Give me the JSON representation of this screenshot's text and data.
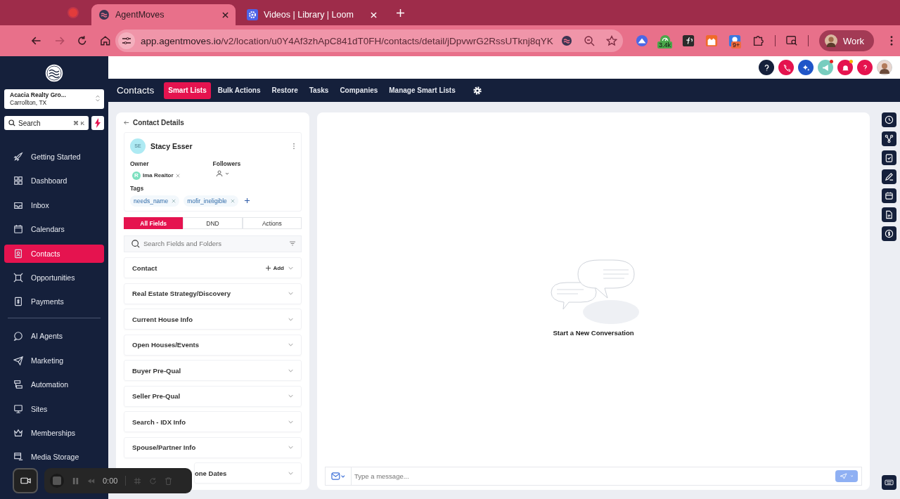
{
  "browser": {
    "tabs": [
      {
        "title": "AgentMoves",
        "selected": true
      },
      {
        "title": "Videos | Library | Loom",
        "selected": false
      }
    ],
    "url_host": "app.agentmoves.io",
    "url_path": "/v2/location/u0Y4Af3zhApC841dT0FH/contacts/detail/jDpvwrG2RssUTknj8qYK",
    "extensions": [
      {
        "kind": "plain"
      },
      {
        "kind": "badged",
        "badge": "3.4k"
      },
      {
        "kind": "plain"
      },
      {
        "kind": "plain"
      },
      {
        "kind": "badged",
        "badge": "9+"
      },
      {
        "kind": "plain"
      }
    ],
    "profile": "Work"
  },
  "sidebar": {
    "account": {
      "name": "Acacia Realty Gro...",
      "location": "Carrollton, TX"
    },
    "search": {
      "label": "Search",
      "shortcut": "⌘ K"
    },
    "nav_groups": [
      {
        "items": [
          {
            "label": "Getting Started",
            "selected": false
          },
          {
            "label": "Dashboard",
            "selected": false
          },
          {
            "label": "Inbox",
            "selected": false
          },
          {
            "label": "Calendars",
            "selected": false
          },
          {
            "label": "Contacts",
            "selected": true
          },
          {
            "label": "Opportunities",
            "selected": false
          },
          {
            "label": "Payments",
            "selected": false
          }
        ]
      },
      {
        "items": [
          {
            "label": "AI Agents",
            "selected": false
          },
          {
            "label": "Marketing",
            "selected": false
          },
          {
            "label": "Automation",
            "selected": false
          },
          {
            "label": "Sites",
            "selected": false
          },
          {
            "label": "Memberships",
            "selected": false
          },
          {
            "label": "Media Storage",
            "selected": false
          }
        ]
      }
    ]
  },
  "topnav": {
    "title": "Contacts",
    "tabs": [
      {
        "label": "Smart Lists",
        "selected": true
      },
      {
        "label": "Bulk Actions",
        "selected": false
      },
      {
        "label": "Restore",
        "selected": false
      },
      {
        "label": "Tasks",
        "selected": false
      },
      {
        "label": "Companies",
        "selected": false
      },
      {
        "label": "Manage Smart Lists",
        "selected": false
      }
    ]
  },
  "contact": {
    "back_label": "Contact Details",
    "initials": "SE",
    "name": "Stacy Esser",
    "owner_label": "Owner",
    "owner": {
      "initial": "R",
      "name": "Ima Realtor"
    },
    "followers_label": "Followers",
    "tags_label": "Tags",
    "tags": [
      "needs_name",
      "mofir_ineligible"
    ],
    "field_tabs": [
      {
        "label": "All Fields",
        "selected": true
      },
      {
        "label": "DND",
        "selected": false
      },
      {
        "label": "Actions",
        "selected": false
      }
    ],
    "field_search": {
      "placeholder": "Search Fields and Folders"
    },
    "sections": [
      {
        "label": "Contact",
        "kind": "addable",
        "add_label": "Add"
      },
      {
        "label": "Real Estate Strategy/Discovery",
        "kind": "plain"
      },
      {
        "label": "Current House Info",
        "kind": "plain"
      },
      {
        "label": "Open Houses/Events",
        "kind": "plain"
      },
      {
        "label": "Buyer Pre-Qual",
        "kind": "plain"
      },
      {
        "label": "Seller Pre-Qual",
        "kind": "plain"
      },
      {
        "label": "Search - IDX Info",
        "kind": "plain"
      },
      {
        "label": "Spouse/Partner Info",
        "kind": "plain"
      },
      {
        "label": "one Dates",
        "kind": "covered"
      }
    ]
  },
  "chat": {
    "empty_title": "Start a New Conversation",
    "composer": {
      "placeholder": "Type a message..."
    }
  },
  "recorder": {
    "time": "0:00"
  }
}
